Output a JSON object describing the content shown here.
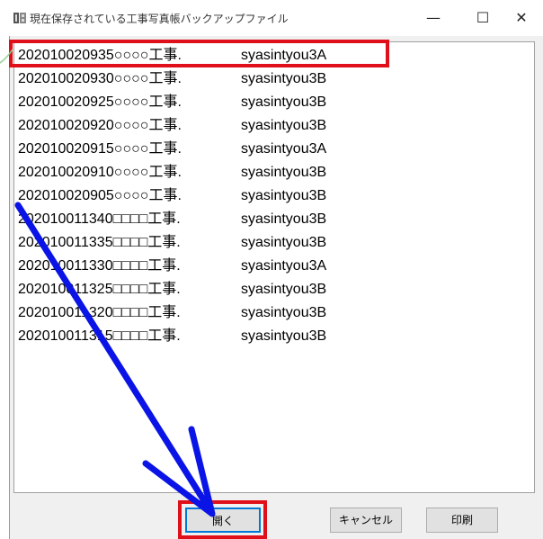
{
  "window": {
    "title": "現在保存されている工事写真帳バックアップファイル",
    "minimize_glyph": "—",
    "maximize_glyph": "☐",
    "close_glyph": "✕"
  },
  "files": [
    {
      "name": "202010020935○○○○工事.",
      "folder": "syasintyou3A"
    },
    {
      "name": "202010020930○○○○工事.",
      "folder": "syasintyou3B"
    },
    {
      "name": "202010020925○○○○工事.",
      "folder": "syasintyou3B"
    },
    {
      "name": "202010020920○○○○工事.",
      "folder": "syasintyou3B"
    },
    {
      "name": "202010020915○○○○工事.",
      "folder": "syasintyou3A"
    },
    {
      "name": "202010020910○○○○工事.",
      "folder": "syasintyou3B"
    },
    {
      "name": "202010020905○○○○工事.",
      "folder": "syasintyou3B"
    },
    {
      "name": "202010011340□□□□工事.",
      "folder": "syasintyou3B"
    },
    {
      "name": "202010011335□□□□工事.",
      "folder": "syasintyou3B"
    },
    {
      "name": "202010011330□□□□工事.",
      "folder": "syasintyou3A"
    },
    {
      "name": "202010011325□□□□工事.",
      "folder": "syasintyou3B"
    },
    {
      "name": "202010011320□□□□工事.",
      "folder": "syasintyou3B"
    },
    {
      "name": "202010011315□□□□工事.",
      "folder": "syasintyou3B"
    }
  ],
  "buttons": {
    "open": "開く",
    "cancel": "キャンセル",
    "print": "印刷"
  },
  "colors": {
    "highlight": "#e0101a",
    "arrow": "#0a14e6",
    "focus": "#0078d7"
  }
}
